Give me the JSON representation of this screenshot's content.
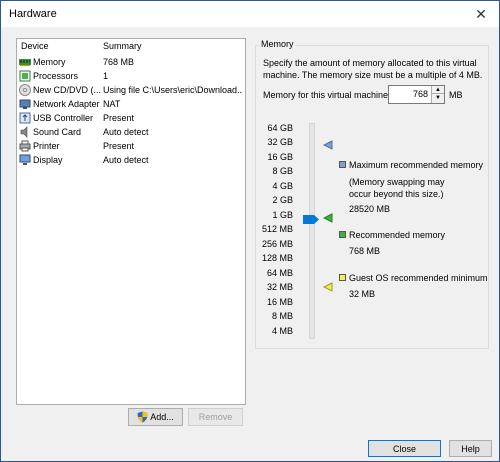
{
  "window": {
    "title": "Hardware"
  },
  "device_table": {
    "headers": {
      "device": "Device",
      "summary": "Summary"
    },
    "rows": [
      {
        "icon": "memory-icon",
        "name": "Memory",
        "summary": "768 MB"
      },
      {
        "icon": "processor-icon",
        "name": "Processors",
        "summary": "1"
      },
      {
        "icon": "cd-dvd-icon",
        "name": "New CD/DVD (...",
        "summary": "Using file C:\\Users\\eric\\Download..."
      },
      {
        "icon": "network-adapter-icon",
        "name": "Network Adapter",
        "summary": "NAT"
      },
      {
        "icon": "usb-controller-icon",
        "name": "USB Controller",
        "summary": "Present"
      },
      {
        "icon": "sound-card-icon",
        "name": "Sound Card",
        "summary": "Auto detect"
      },
      {
        "icon": "printer-icon",
        "name": "Printer",
        "summary": "Present"
      },
      {
        "icon": "display-icon",
        "name": "Display",
        "summary": "Auto detect"
      }
    ]
  },
  "buttons": {
    "add": "Add...",
    "remove": "Remove",
    "close": "Close",
    "help": "Help"
  },
  "memory": {
    "group_label": "Memory",
    "description": "Specify the amount of memory allocated to this virtual machine. The memory size must be a multiple of 4 MB.",
    "field_label": "Memory for this virtual machine:",
    "value": "768",
    "unit": "MB",
    "scale": [
      "64 GB",
      "32 GB",
      "16 GB",
      "8 GB",
      "4 GB",
      "2 GB",
      "1 GB",
      "512 MB",
      "256 MB",
      "128 MB",
      "64 MB",
      "32 MB",
      "16 MB",
      "8 MB",
      "4 MB"
    ],
    "max_recommended": {
      "label": "Maximum recommended memory",
      "note": "(Memory swapping may occur beyond this size.)",
      "value": "28520 MB",
      "color": "#7f9fd6"
    },
    "recommended": {
      "label": "Recommended memory",
      "value": "768 MB",
      "color": "#3cb33c"
    },
    "guest_min": {
      "label": "Guest OS recommended minimum",
      "value": "32 MB",
      "color": "#f0f050"
    }
  }
}
